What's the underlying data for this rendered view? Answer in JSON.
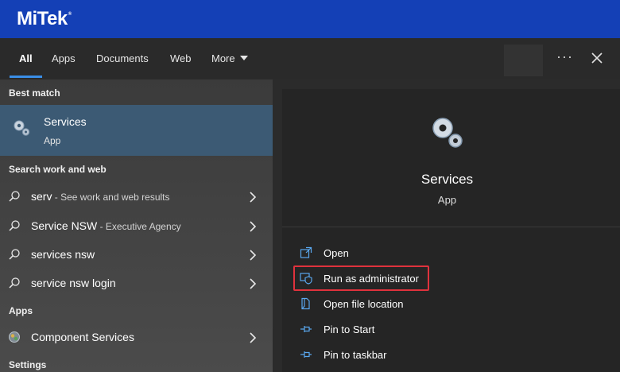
{
  "brand": {
    "name": "MiTek",
    "reg": "®"
  },
  "tabs": [
    {
      "label": "All"
    },
    {
      "label": "Apps"
    },
    {
      "label": "Documents"
    },
    {
      "label": "Web"
    },
    {
      "label": "More"
    }
  ],
  "left": {
    "best_match_heading": "Best match",
    "best_match": {
      "title": "Services",
      "subtitle": "App",
      "icon": "gears-icon"
    },
    "search_heading": "Search work and web",
    "search_results": [
      {
        "main": "serv",
        "sub": " - See work and web results"
      },
      {
        "main": "Service NSW",
        "sub": " - Executive Agency"
      },
      {
        "main": "services nsw",
        "sub": ""
      },
      {
        "main": "service nsw login",
        "sub": ""
      }
    ],
    "apps_heading": "Apps",
    "apps": [
      {
        "label": "Component Services",
        "icon": "component-services-icon"
      }
    ],
    "settings_heading": "Settings"
  },
  "right": {
    "title": "Services",
    "subtitle": "App",
    "actions": [
      {
        "label": "Open",
        "icon": "open-icon"
      },
      {
        "label": "Run as administrator",
        "icon": "shield-icon"
      },
      {
        "label": "Open file location",
        "icon": "file-location-icon"
      },
      {
        "label": "Pin to Start",
        "icon": "pin-icon"
      },
      {
        "label": "Pin to taskbar",
        "icon": "pin-icon"
      }
    ]
  },
  "colors": {
    "brand_bar": "#1440b6",
    "accent_underline": "#3a8ee6",
    "selected_row": "#3c5a74",
    "highlight_box": "#e0323d"
  }
}
